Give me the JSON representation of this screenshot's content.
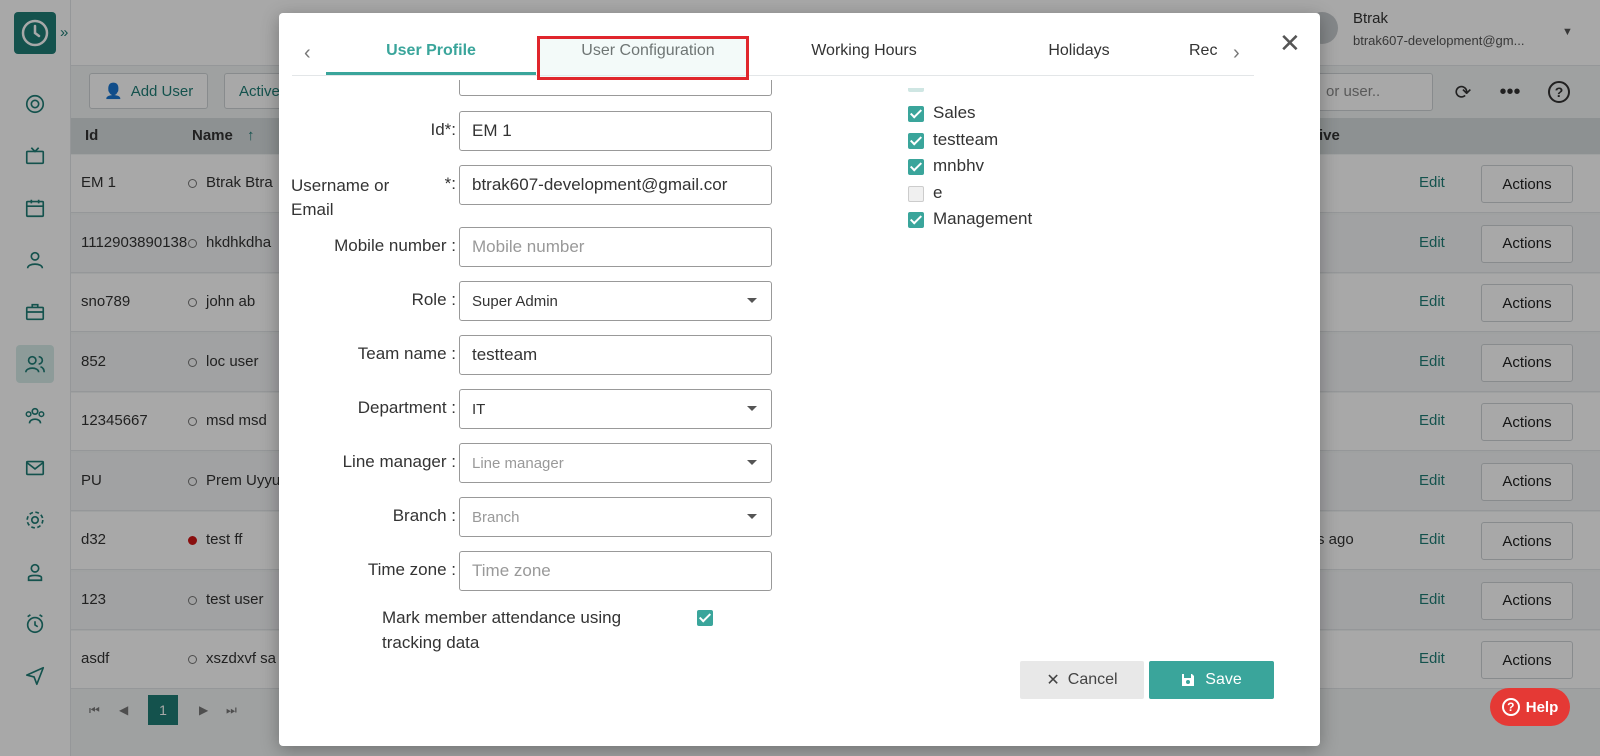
{
  "colors": {
    "brand": "#1f7d76",
    "accent": "#3aa59b",
    "highlight_border": "#e0262c",
    "help": "#e53935"
  },
  "header": {
    "user_name": "Btrak",
    "user_email": "btrak607-development@gm..."
  },
  "toolbar": {
    "add_user_label": "Add User",
    "active_label": "Active",
    "search_placeholder": "or user.."
  },
  "table": {
    "col_id": "Id",
    "col_name": "Name",
    "col_active": "tive",
    "rows": [
      {
        "id": "EM 1",
        "name": "Btrak Btra",
        "extra": "",
        "edit": "Edit",
        "actions": "Actions"
      },
      {
        "id": "1112903890138",
        "name": "hkdhkdha",
        "extra": "",
        "edit": "Edit",
        "actions": "Actions"
      },
      {
        "id": "sno789",
        "name": "john ab",
        "extra": "",
        "edit": "Edit",
        "actions": "Actions"
      },
      {
        "id": "852",
        "name": "loc user",
        "extra": "",
        "edit": "Edit",
        "actions": "Actions"
      },
      {
        "id": "12345667",
        "name": "msd msd",
        "extra": "",
        "edit": "Edit",
        "actions": "Actions"
      },
      {
        "id": "PU",
        "name": "Prem Uyyu",
        "extra": "",
        "edit": "Edit",
        "actions": "Actions"
      },
      {
        "id": "d32",
        "name": "test ff",
        "extra": "s ago",
        "edit": "Edit",
        "actions": "Actions"
      },
      {
        "id": "123",
        "name": "test user",
        "extra": "",
        "edit": "Edit",
        "actions": "Actions"
      },
      {
        "id": "asdf",
        "name": "xszdxvf sa",
        "extra": "",
        "edit": "Edit",
        "actions": "Actions"
      }
    ]
  },
  "pager": {
    "current_page": "1"
  },
  "help_label": "Help",
  "dialog": {
    "tabs": [
      {
        "label": "User Profile"
      },
      {
        "label": "User Configuration"
      },
      {
        "label": "Working Hours"
      },
      {
        "label": "Holidays"
      },
      {
        "label": "Rec"
      }
    ],
    "form": {
      "id_label": "Id*:",
      "id_value": "EM 1",
      "username_label": "Username or Email",
      "username_required": "*:",
      "username_value": "btrak607-development@gmail.cor",
      "mobile_label": "Mobile number :",
      "mobile_placeholder": "Mobile number",
      "role_label": "Role :",
      "role_value": "Super Admin",
      "team_label": "Team name :",
      "team_value": "testteam",
      "department_label": "Department :",
      "department_value": "IT",
      "line_manager_label": "Line manager :",
      "line_manager_placeholder": "Line manager",
      "branch_label": "Branch :",
      "branch_placeholder": "Branch",
      "timezone_label": "Time zone :",
      "timezone_placeholder": "Time zone",
      "attendance_label": "Mark member attendance using tracking data",
      "attendance_checked": true
    },
    "teams": [
      {
        "label": "Sales",
        "checked": true
      },
      {
        "label": "testteam",
        "checked": true
      },
      {
        "label": "mnbhv",
        "checked": true
      },
      {
        "label": "e",
        "checked": false
      },
      {
        "label": "Management",
        "checked": true
      }
    ],
    "cancel_label": "Cancel",
    "save_label": "Save"
  }
}
